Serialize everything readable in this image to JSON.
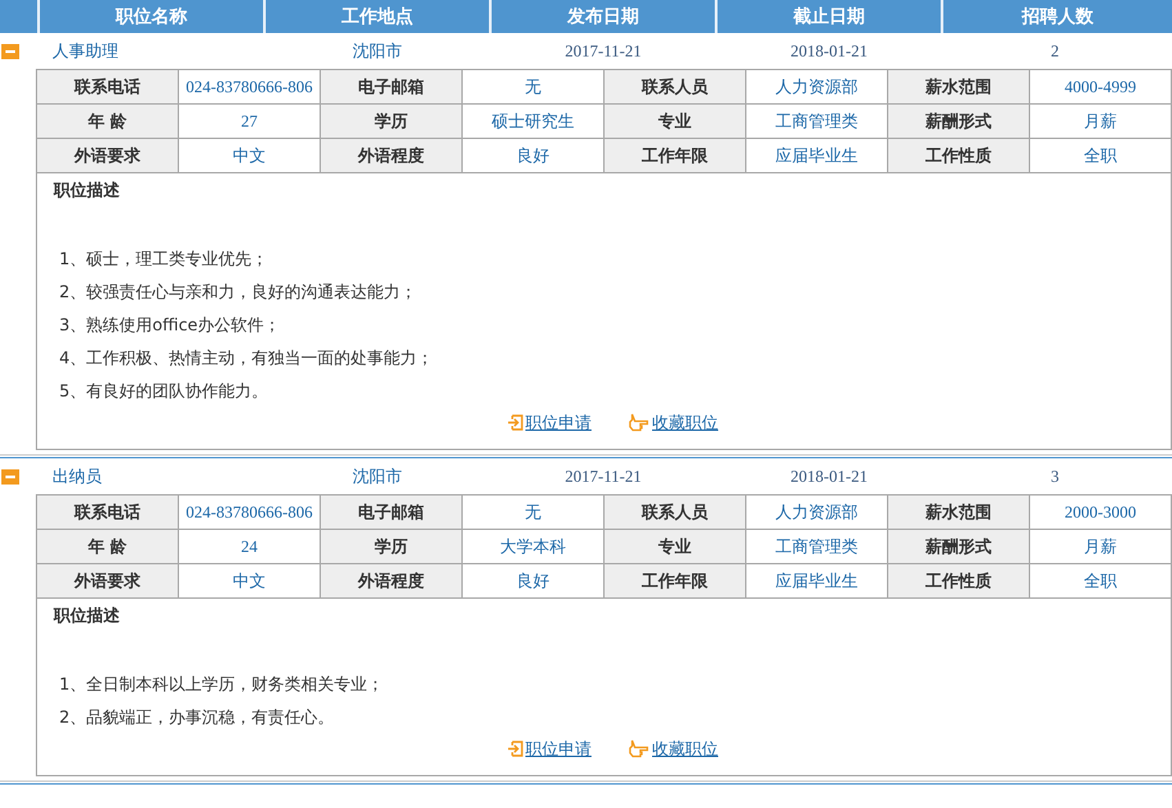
{
  "header": {
    "columns": [
      "职位名称",
      "工作地点",
      "发布日期",
      "截止日期",
      "招聘人数"
    ]
  },
  "jobs": [
    {
      "expanded": true,
      "title": "人事助理",
      "location": "沈阳市",
      "publish_date": "2017-11-21",
      "deadline": "2018-01-21",
      "openings": "2",
      "details": [
        [
          {
            "label": "联系电话",
            "value": "024-83780666-806"
          },
          {
            "label": "电子邮箱",
            "value": "无"
          },
          {
            "label": "联系人员",
            "value": "人力资源部"
          },
          {
            "label": "薪水范围",
            "value": "4000-4999"
          }
        ],
        [
          {
            "label": "年 龄",
            "value": "27"
          },
          {
            "label": "学历",
            "value": "硕士研究生"
          },
          {
            "label": "专业",
            "value": "工商管理类"
          },
          {
            "label": "薪酬形式",
            "value": "月薪"
          }
        ],
        [
          {
            "label": "外语要求",
            "value": "中文"
          },
          {
            "label": "外语程度",
            "value": "良好"
          },
          {
            "label": "工作年限",
            "value": "应届毕业生"
          },
          {
            "label": "工作性质",
            "value": "全职"
          }
        ]
      ],
      "description": {
        "title": "职位描述",
        "lines": [
          "1、硕士，理工类专业优先；",
          "2、较强责任心与亲和力，良好的沟通表达能力；",
          "3、熟练使用office办公软件；",
          "4、工作积极、热情主动，有独当一面的处事能力；",
          "5、有良好的团队协作能力。"
        ]
      },
      "actions": [
        {
          "kind": "apply",
          "label": "职位申请"
        },
        {
          "kind": "favorite",
          "label": "收藏职位"
        }
      ]
    },
    {
      "expanded": true,
      "title": "出纳员",
      "location": "沈阳市",
      "publish_date": "2017-11-21",
      "deadline": "2018-01-21",
      "openings": "3",
      "details": [
        [
          {
            "label": "联系电话",
            "value": "024-83780666-806"
          },
          {
            "label": "电子邮箱",
            "value": "无"
          },
          {
            "label": "联系人员",
            "value": "人力资源部"
          },
          {
            "label": "薪水范围",
            "value": "2000-3000"
          }
        ],
        [
          {
            "label": "年 龄",
            "value": "24"
          },
          {
            "label": "学历",
            "value": "大学本科"
          },
          {
            "label": "专业",
            "value": "工商管理类"
          },
          {
            "label": "薪酬形式",
            "value": "月薪"
          }
        ],
        [
          {
            "label": "外语要求",
            "value": "中文"
          },
          {
            "label": "外语程度",
            "value": "良好"
          },
          {
            "label": "工作年限",
            "value": "应届毕业生"
          },
          {
            "label": "工作性质",
            "value": "全职"
          }
        ]
      ],
      "description": {
        "title": "职位描述",
        "lines": [
          "1、全日制本科以上学历，财务类相关专业；",
          "2、品貌端正，办事沉稳，有责任心。"
        ]
      },
      "actions": [
        {
          "kind": "apply",
          "label": "职位申请"
        },
        {
          "kind": "favorite",
          "label": "收藏职位"
        }
      ]
    }
  ]
}
